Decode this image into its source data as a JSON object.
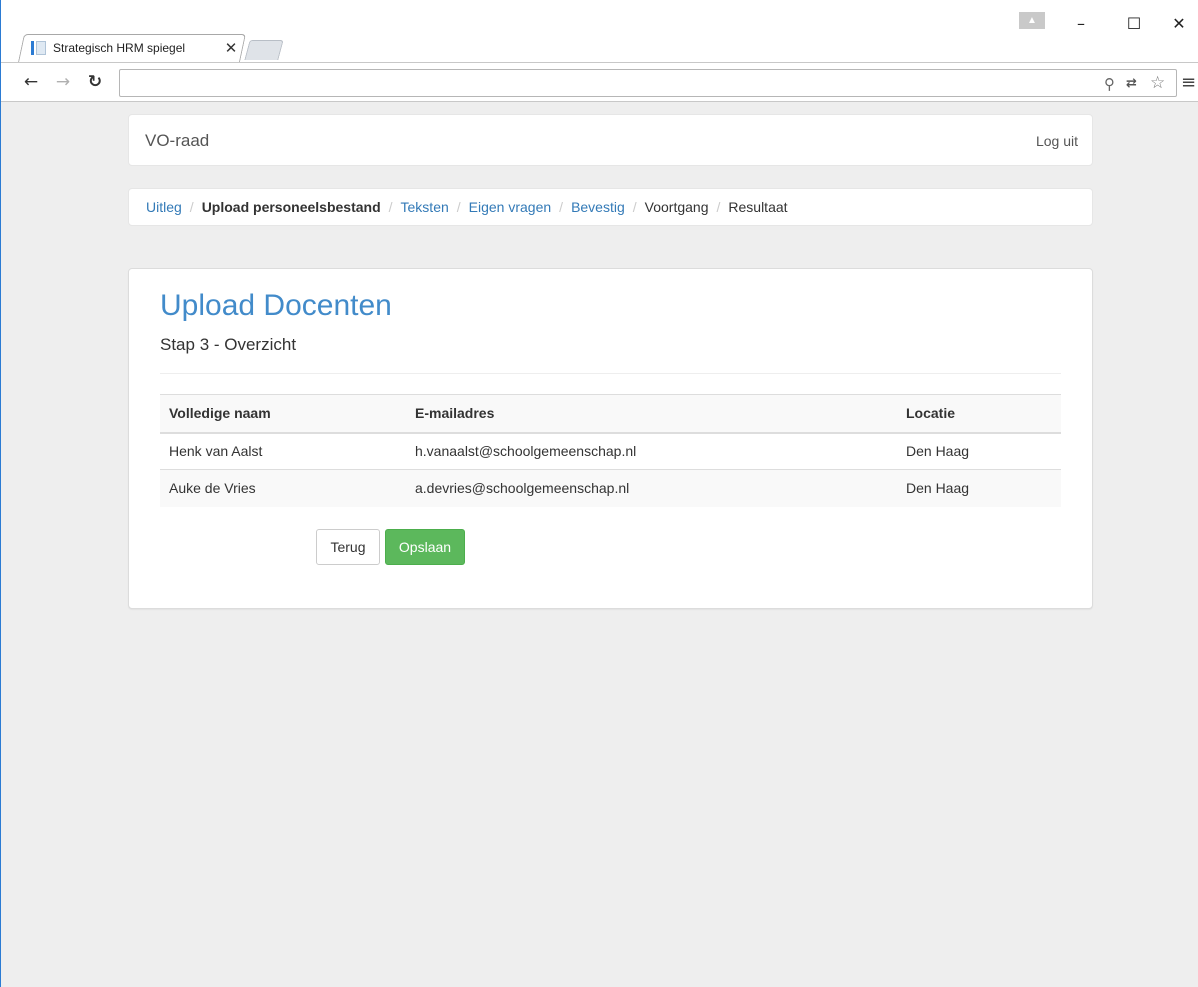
{
  "browser": {
    "tab_title": "Strategisch HRM spiegel",
    "tab_close": "✕",
    "address": "",
    "window_controls": {
      "minimize": "–",
      "maximize": "☐",
      "close": "✕"
    },
    "icons": [
      "back-arrow-icon",
      "forward-arrow-icon",
      "reload-icon",
      "zoom-icon",
      "translate-icon",
      "star-icon",
      "menu-icon",
      "profile-icon"
    ]
  },
  "navbar": {
    "brand": "VO-raad",
    "logout": "Log uit"
  },
  "breadcrumb": [
    {
      "label": "Uitleg",
      "state": "link"
    },
    {
      "label": "Upload personeelsbestand",
      "state": "active"
    },
    {
      "label": "Teksten",
      "state": "link"
    },
    {
      "label": "Eigen vragen",
      "state": "link"
    },
    {
      "label": "Bevestig",
      "state": "link"
    },
    {
      "label": "Voortgang",
      "state": "plain"
    },
    {
      "label": "Resultaat",
      "state": "plain"
    }
  ],
  "breadcrumb_separator": "/",
  "main": {
    "title": "Upload Docenten",
    "subtitle": "Stap 3 - Overzicht",
    "table": {
      "headers": [
        "Volledige naam",
        "E-mailadres",
        "Locatie"
      ],
      "rows": [
        [
          "Henk van Aalst",
          "h.vanaalst@schoolgemeenschap.nl",
          "Den Haag"
        ],
        [
          "Auke de Vries",
          "a.devries@schoolgemeenschap.nl",
          "Den Haag"
        ]
      ]
    },
    "buttons": {
      "back": "Terug",
      "save": "Opslaan"
    }
  },
  "colors": {
    "link": "#337ab7",
    "title": "#428bca",
    "save_button": "#5cb85c",
    "background": "#eeeeee"
  }
}
